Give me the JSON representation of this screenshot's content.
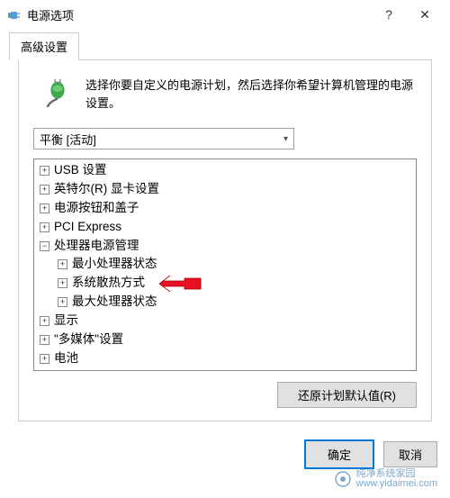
{
  "window": {
    "title": "电源选项",
    "help_label": "?",
    "close_label": "✕"
  },
  "tab": {
    "label": "高级设置"
  },
  "description": "选择你要自定义的电源计划，然后选择你希望计算机管理的电源设置。",
  "plan_dropdown": {
    "selected": "平衡 [活动]"
  },
  "tree": {
    "items": [
      {
        "expanded": false,
        "level": 0,
        "label": "USB 设置"
      },
      {
        "expanded": false,
        "level": 0,
        "label": "英特尔(R) 显卡设置"
      },
      {
        "expanded": false,
        "level": 0,
        "label": "电源按钮和盖子"
      },
      {
        "expanded": false,
        "level": 0,
        "label": "PCI Express"
      },
      {
        "expanded": true,
        "level": 0,
        "label": "处理器电源管理"
      },
      {
        "expanded": false,
        "level": 1,
        "label": "最小处理器状态"
      },
      {
        "expanded": false,
        "level": 1,
        "label": "系统散热方式",
        "arrow": true
      },
      {
        "expanded": false,
        "level": 1,
        "label": "最大处理器状态"
      },
      {
        "expanded": false,
        "level": 0,
        "label": "显示"
      },
      {
        "expanded": false,
        "level": 0,
        "label": "\"多媒体\"设置"
      },
      {
        "expanded": false,
        "level": 0,
        "label": "电池"
      }
    ]
  },
  "buttons": {
    "restore_defaults": "还原计划默认值(R)",
    "ok": "确定",
    "cancel": "取消"
  },
  "watermark": {
    "line1": "纯净系统家园",
    "line2": "www.yidaimei.com"
  }
}
